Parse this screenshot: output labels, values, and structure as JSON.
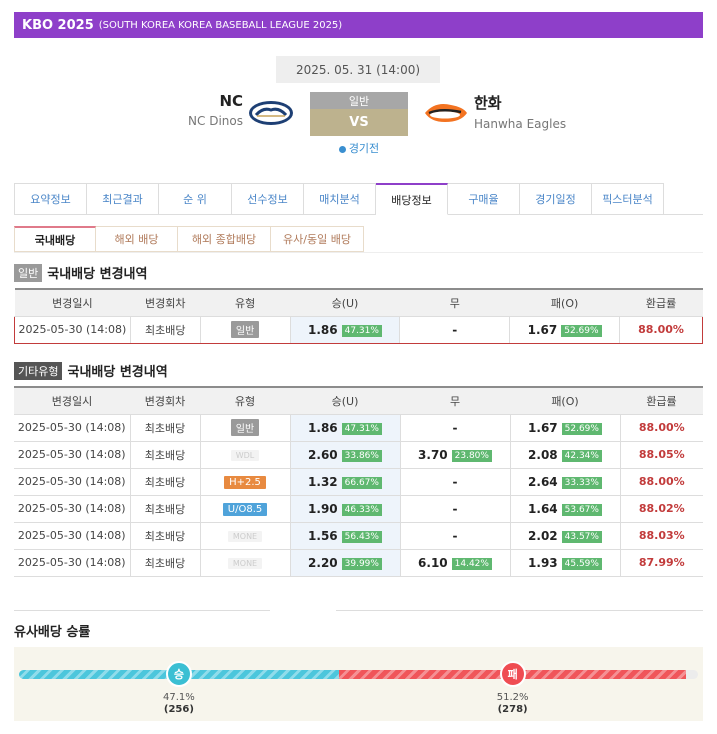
{
  "header": {
    "league": "KBO 2025",
    "subtitle": "(SOUTH KOREA KOREA BASEBALL LEAGUE 2025)"
  },
  "match": {
    "datetime": "2025. 05. 31 (14:00)",
    "type": "일반",
    "vs": "VS",
    "status": "경기전",
    "home": {
      "abbr": "NC",
      "name": "NC Dinos",
      "logo": "dinos-logo"
    },
    "away": {
      "abbr": "한화",
      "name": "Hanwha Eagles",
      "logo": "eagles-logo"
    }
  },
  "tabs": [
    "요약정보",
    "최근결과",
    "순 위",
    "선수정보",
    "매치분석",
    "배당정보",
    "구매율",
    "경기일정",
    "픽스터분석"
  ],
  "active_tab": 5,
  "subtabs": [
    "국내배당",
    "해외 배당",
    "해외 종합배당",
    "유사/동일 배당"
  ],
  "active_subtab": 0,
  "section1": {
    "badge": "일반",
    "title": "국내배당 변경내역",
    "headers": [
      "변경일시",
      "변경회차",
      "유형",
      "승(U)",
      "무",
      "패(O)",
      "환급률"
    ],
    "rows": [
      {
        "time": "2025-05-30 (14:08)",
        "round": "최초배당",
        "type": "일반",
        "type_style": "gray",
        "win": "1.86",
        "win_pct": "47.31%",
        "draw": "-",
        "draw_pct": "",
        "lose": "1.67",
        "lose_pct": "52.69%",
        "refund": "88.00%"
      }
    ]
  },
  "section2": {
    "badge": "기타유형",
    "title": "국내배당 변경내역",
    "headers": [
      "변경일시",
      "변경회차",
      "유형",
      "승(U)",
      "무",
      "패(O)",
      "환급률"
    ],
    "rows": [
      {
        "time": "2025-05-30 (14:08)",
        "round": "최초배당",
        "type": "일반",
        "type_style": "gray",
        "win": "1.86",
        "win_pct": "47.31%",
        "draw": "-",
        "draw_pct": "",
        "lose": "1.67",
        "lose_pct": "52.69%",
        "refund": "88.00%"
      },
      {
        "time": "2025-05-30 (14:08)",
        "round": "최초배당",
        "type": "WDL",
        "type_style": "light",
        "win": "2.60",
        "win_pct": "33.86%",
        "draw": "3.70",
        "draw_pct": "23.80%",
        "lose": "2.08",
        "lose_pct": "42.34%",
        "refund": "88.05%"
      },
      {
        "time": "2025-05-30 (14:08)",
        "round": "최초배당",
        "type": "H+2.5",
        "type_style": "orange",
        "win": "1.32",
        "win_pct": "66.67%",
        "draw": "-",
        "draw_pct": "",
        "lose": "2.64",
        "lose_pct": "33.33%",
        "refund": "88.00%"
      },
      {
        "time": "2025-05-30 (14:08)",
        "round": "최초배당",
        "type": "U/O8.5",
        "type_style": "blue",
        "win": "1.90",
        "win_pct": "46.33%",
        "draw": "-",
        "draw_pct": "",
        "lose": "1.64",
        "lose_pct": "53.67%",
        "refund": "88.02%"
      },
      {
        "time": "2025-05-30 (14:08)",
        "round": "최초배당",
        "type": "MONE",
        "type_style": "light",
        "win": "1.56",
        "win_pct": "56.43%",
        "draw": "-",
        "draw_pct": "",
        "lose": "2.02",
        "lose_pct": "43.57%",
        "refund": "88.03%"
      },
      {
        "time": "2025-05-30 (14:08)",
        "round": "최초배당",
        "type": "MONE",
        "type_style": "light",
        "win": "2.20",
        "win_pct": "39.99%",
        "draw": "6.10",
        "draw_pct": "14.42%",
        "lose": "1.93",
        "lose_pct": "45.59%",
        "refund": "87.99%"
      }
    ]
  },
  "similar": {
    "title": "유사배당 승률",
    "win": {
      "label": "승",
      "pct": "47.1%",
      "count": "(256)",
      "fraction": 0.471
    },
    "lose": {
      "label": "패",
      "pct": "51.2%",
      "count": "(278)",
      "fraction": 0.512
    },
    "colors": {
      "win": "#3bbfd3",
      "lose": "#ef4c52"
    }
  }
}
